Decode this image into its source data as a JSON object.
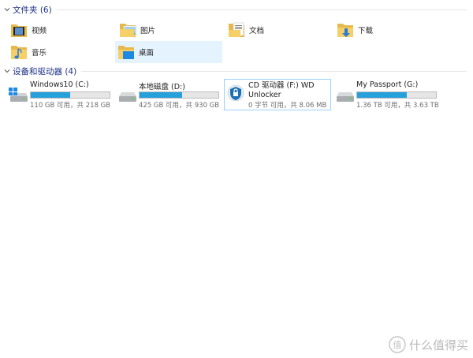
{
  "folders_group": {
    "title": "文件夹 (6)"
  },
  "folders": [
    {
      "label": "视频",
      "icon": "video-folder-icon"
    },
    {
      "label": "图片",
      "icon": "pictures-folder-icon"
    },
    {
      "label": "文档",
      "icon": "documents-folder-icon"
    },
    {
      "label": "下载",
      "icon": "downloads-folder-icon"
    },
    {
      "label": "音乐",
      "icon": "music-folder-icon"
    },
    {
      "label": "桌面",
      "icon": "desktop-folder-icon",
      "selected": true
    }
  ],
  "drives_group": {
    "title": "设备和驱动器 (4)"
  },
  "drives": [
    {
      "name": "Windows10 (C:)",
      "space": "110 GB 可用，共 218 GB",
      "used_fraction": 0.495,
      "icon": "windows-drive-icon"
    },
    {
      "name": "本地磁盘 (D:)",
      "space": "425 GB 可用，共 930 GB",
      "used_fraction": 0.543,
      "icon": "hard-drive-icon"
    },
    {
      "name": "CD 驱动器 (F:) WD Unlocker",
      "space": "0 字节 可用，共 8.06 MB",
      "icon": "wd-unlocker-icon"
    },
    {
      "name": "My Passport (G:)",
      "space": "1.36 TB 可用，共 3.63 TB",
      "used_fraction": 0.625,
      "icon": "hard-drive-icon"
    }
  ],
  "colors": {
    "header_text": "#1e3287",
    "bar_fill": "#26a0da",
    "selected_bg": "#e5f3ff"
  },
  "watermark": {
    "text": "什么值得买"
  }
}
